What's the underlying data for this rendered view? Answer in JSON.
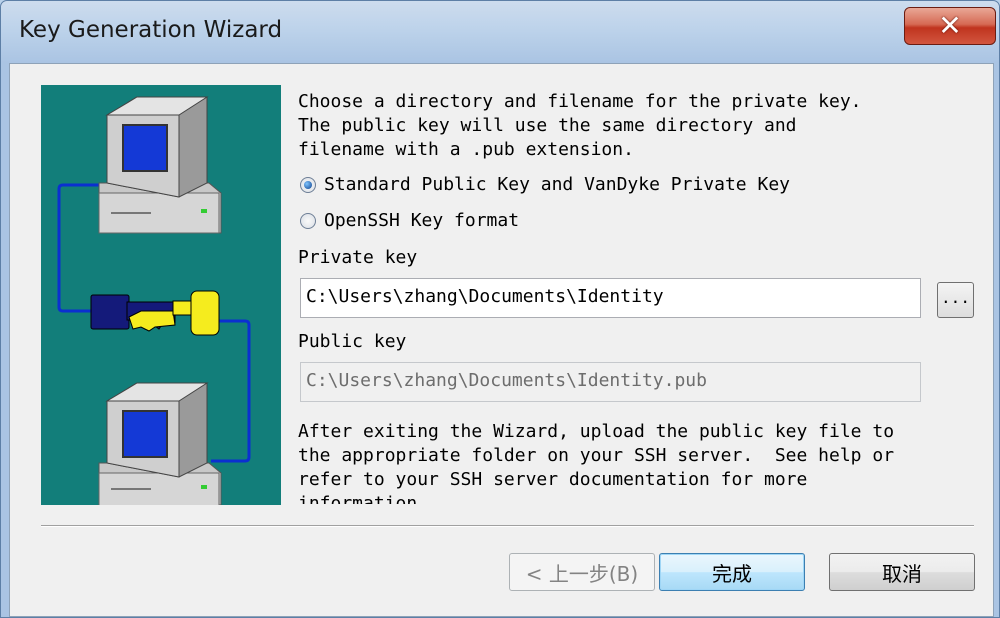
{
  "window": {
    "title": "Key Generation Wizard"
  },
  "intro": {
    "line1": "Choose a directory and filename for the private key.",
    "line2": "The public key will use the same directory and",
    "line3": "filename with a .pub extension."
  },
  "format": {
    "option_standard": "Standard Public Key and VanDyke Private Key",
    "option_openssh": "OpenSSH Key format",
    "selected": "Standard Public Key and VanDyke Private Key"
  },
  "private_key": {
    "label": "Private key",
    "value": "C:\\Users\\zhang\\Documents\\Identity",
    "browse_label": "..."
  },
  "public_key": {
    "label": "Public key",
    "value": "C:\\Users\\zhang\\Documents\\Identity.pub"
  },
  "note": {
    "line1": "After exiting the Wizard, upload the public key file to",
    "line2": "the appropriate folder on your SSH server.  See help or",
    "line3": "refer to your SSH server documentation for more",
    "line4": "information."
  },
  "buttons": {
    "back": "< 上一步(B)",
    "finish": "完成",
    "cancel": "取消"
  },
  "colors": {
    "illustration_bg": "#127e7a",
    "screen": "#1439d6",
    "key_left": "#141a7a",
    "key_right": "#f5ec1e",
    "cable": "#0b2fd1"
  }
}
